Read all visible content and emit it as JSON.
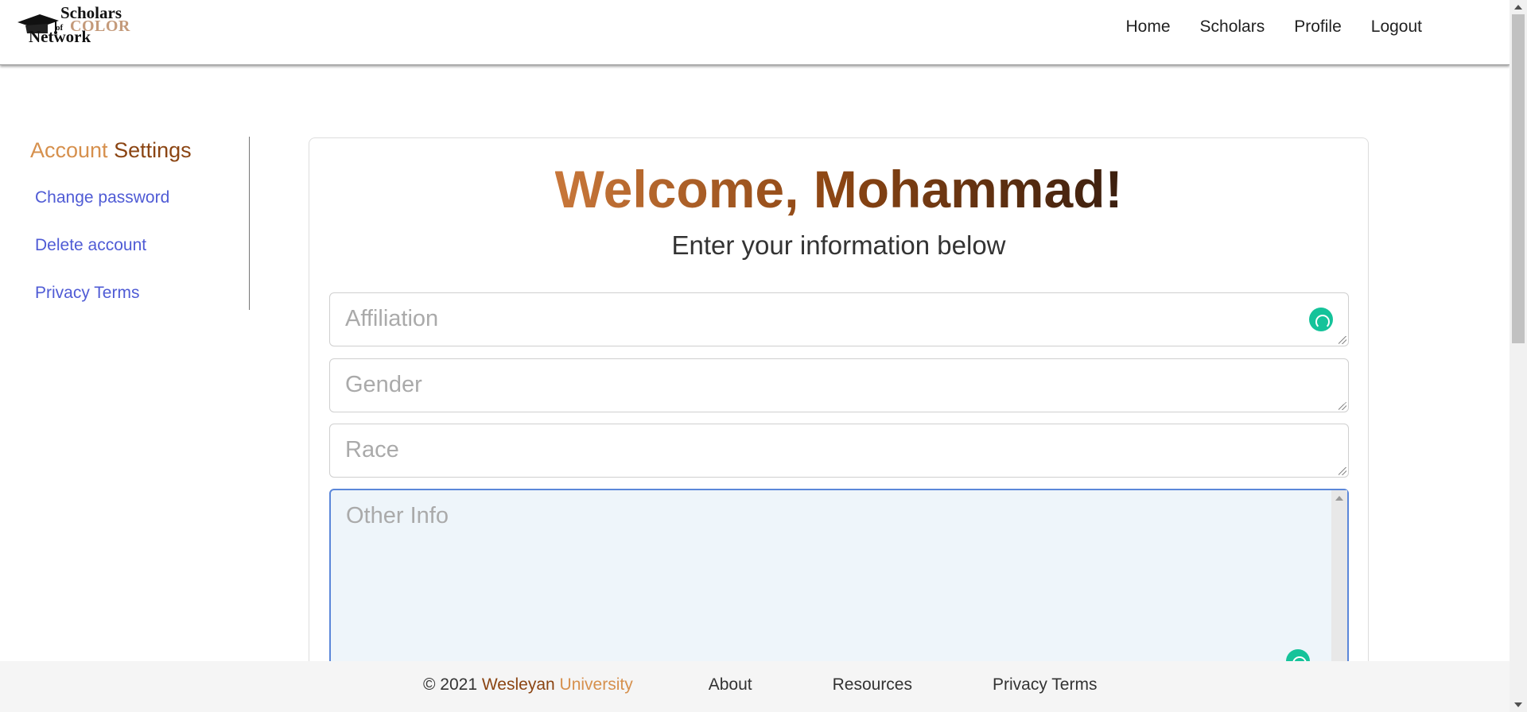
{
  "logo": {
    "line1": "Scholars",
    "line2_of": "of",
    "line2_color": "COLOR",
    "line3": "Network",
    "icon": "graduation-cap-icon"
  },
  "nav": {
    "home": "Home",
    "scholars": "Scholars",
    "profile": "Profile",
    "logout": "Logout"
  },
  "sidebar": {
    "title_part1": "Account",
    "title_part2": " Settings",
    "links": [
      {
        "label": "Change password"
      },
      {
        "label": "Delete account"
      },
      {
        "label": "Privacy Terms"
      }
    ]
  },
  "form": {
    "welcome": "Welcome, Mohammad!",
    "subtitle": "Enter your information below",
    "fields": [
      {
        "placeholder": "Affiliation"
      },
      {
        "placeholder": "Gender"
      },
      {
        "placeholder": "Race"
      },
      {
        "placeholder": "Other Info"
      }
    ]
  },
  "footer": {
    "copyright": "© 2021 ",
    "org_part1": "Wesleyan",
    "org_part2": " University",
    "about": "About",
    "resources": "Resources",
    "privacy": "Privacy Terms"
  },
  "colors": {
    "accent_light": "#d6904d",
    "accent_dark": "#8b4513",
    "link": "#4f5bd5",
    "grammarly": "#15c39a"
  }
}
